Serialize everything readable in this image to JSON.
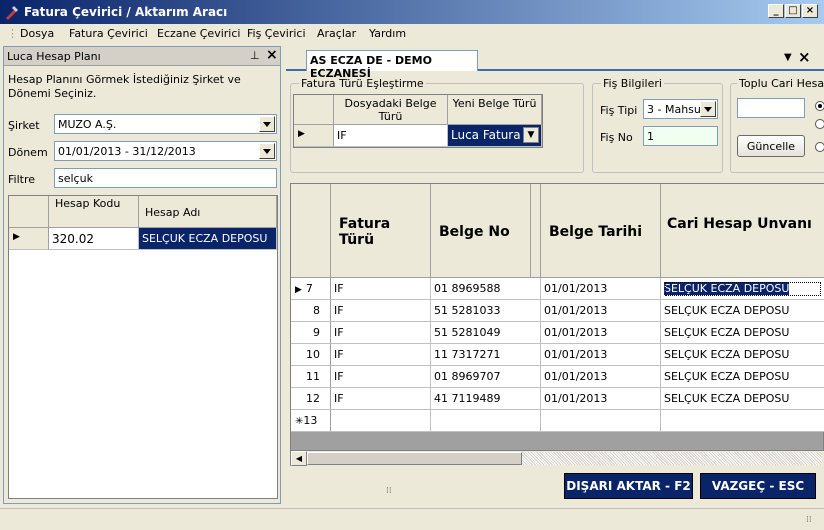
{
  "window": {
    "title": "Fatura Çevirici / Aktarım Aracı"
  },
  "menu": [
    "Dosya",
    "Fatura Çevirici",
    "Eczane Çevirici",
    "Fiş Çevirici",
    "Araçlar",
    "Yardım"
  ],
  "left_panel": {
    "title": "Luca Hesap Planı",
    "description": "Hesap Planını Görmek İstediğiniz Şirket ve Dönemi Seçiniz.",
    "sirket_label": "Şirket",
    "sirket_value": "MUZO A.Ş.",
    "donem_label": "Dönem",
    "donem_value": "01/01/2013 - 31/12/2013",
    "filtre_label": "Filtre",
    "filtre_value": "selçuk",
    "grid": {
      "headers": [
        "Hesap Kodu",
        "Hesap Adı"
      ],
      "rows": [
        [
          "320.02",
          "SELÇUK ECZA DEPOSU"
        ]
      ]
    }
  },
  "right_panel": {
    "tab": "AS ECZA DE - DEMO ECZANESİ",
    "fatura_turu": {
      "title": "Fatura Türü Eşleştirme",
      "headers": [
        "Dosyadaki Belge Türü",
        "Yeni Belge Türü"
      ],
      "row": {
        "dosyadaki": "IF",
        "yeni": "Luca Fatura"
      }
    },
    "fis_bilgileri": {
      "title": "Fiş Bilgileri",
      "tipi_label": "Fiş Tipi",
      "tipi_value": "3 - Mahsu",
      "no_label": "Fiş No",
      "no_value": "1"
    },
    "toplu_cari": {
      "title": "Toplu Cari Hesap",
      "input_value": "",
      "button": "Güncelle"
    },
    "main_grid": {
      "headers": [
        "Fatura Türü",
        "Belge No",
        "Belge Tarihi",
        "Cari Hesap Unvanı"
      ],
      "rows": [
        {
          "n": "7",
          "tur": "IF",
          "no": "01 8969588",
          "tarih": "01/01/2013",
          "cari": "SELÇUK ECZA DEPOSU"
        },
        {
          "n": "8",
          "tur": "IF",
          "no": "51 5281033",
          "tarih": "01/01/2013",
          "cari": "SELÇUK ECZA DEPOSU"
        },
        {
          "n": "9",
          "tur": "IF",
          "no": "51 5281049",
          "tarih": "01/01/2013",
          "cari": "SELÇUK ECZA DEPOSU"
        },
        {
          "n": "10",
          "tur": "IF",
          "no": "11 7317271",
          "tarih": "01/01/2013",
          "cari": "SELÇUK ECZA DEPOSU"
        },
        {
          "n": "11",
          "tur": "IF",
          "no": "01 8969707",
          "tarih": "01/01/2013",
          "cari": "SELÇUK ECZA DEPOSU"
        },
        {
          "n": "12",
          "tur": "IF",
          "no": "41 7119489",
          "tarih": "01/01/2013",
          "cari": "SELÇUK ECZA DEPOSU"
        }
      ],
      "new_row": "13"
    },
    "buttons": {
      "export": "DIŞARI AKTAR - F2",
      "cancel": "VAZGEÇ - ESC"
    }
  }
}
